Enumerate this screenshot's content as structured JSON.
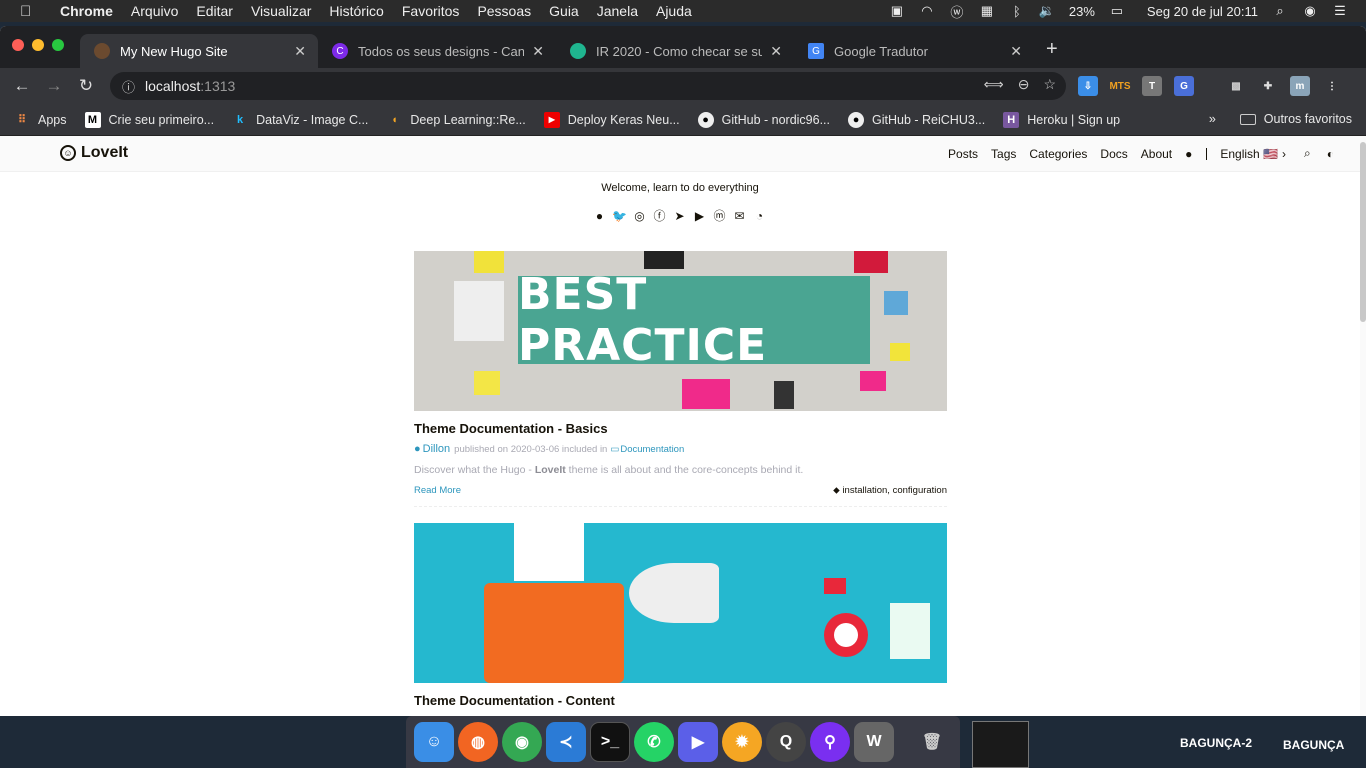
{
  "menubar": {
    "app": "Chrome",
    "items": [
      "Arquivo",
      "Editar",
      "Visualizar",
      "Histórico",
      "Favoritos",
      "Pessoas",
      "Guia",
      "Janela",
      "Ajuda"
    ],
    "battery": "23%",
    "clock": "Seg 20 de jul  20:11"
  },
  "tabs": [
    {
      "title": "My New Hugo Site",
      "color": "#6b4a2f"
    },
    {
      "title": "Todos os seus designs - Canva",
      "color": "#7d2ae8"
    },
    {
      "title": "IR 2020 - Como checar se sua",
      "color": "#1fb58f"
    },
    {
      "title": "Google Tradutor",
      "color": "#4285f4"
    }
  ],
  "address": {
    "host": "localhost",
    "port": ":1313"
  },
  "bookmarks": [
    {
      "label": "Apps",
      "icon": "apps-grid-icon"
    },
    {
      "label": "Crie seu primeiro...",
      "icon": "medium-icon"
    },
    {
      "label": "DataViz - Image C...",
      "icon": "k-icon"
    },
    {
      "label": "Deep Learning::Re...",
      "icon": "dl-icon"
    },
    {
      "label": "Deploy Keras Neu...",
      "icon": "youtube-icon"
    },
    {
      "label": "GitHub - nordic96...",
      "icon": "github-icon"
    },
    {
      "label": "GitHub - ReiCHU3...",
      "icon": "github-icon"
    },
    {
      "label": "Heroku | Sign up",
      "icon": "heroku-icon"
    }
  ],
  "bookmarks_other": "Outros favoritos",
  "site": {
    "logo": "LoveIt",
    "nav": [
      "Posts",
      "Tags",
      "Categories",
      "Docs",
      "About"
    ],
    "language": "English 🇺🇸",
    "welcome": "Welcome, learn to do everything"
  },
  "posts": [
    {
      "image_text": "BEST PRACTICE",
      "title": "Theme Documentation - Basics",
      "author": "Dillon",
      "published": "published on 2020-03-06 included in",
      "category": "Documentation",
      "summary_pre": "Discover what the Hugo - ",
      "summary_bold": "LoveIt",
      "summary_post": " theme is all about and the core-concepts behind it.",
      "read_more": "Read More",
      "tags": "installation, configuration"
    },
    {
      "title": "Theme Documentation - Content"
    }
  ],
  "desktops": [
    "BAGUNÇA-2",
    "BAGUNÇA"
  ]
}
